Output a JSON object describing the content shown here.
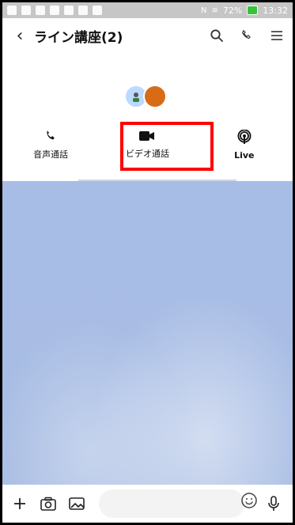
{
  "status_bar": {
    "battery_percent": "72%",
    "time": "13:32"
  },
  "header": {
    "title": "ライン講座(2)"
  },
  "call_options": [
    {
      "label": "音声通話"
    },
    {
      "label": "ビデオ通話"
    },
    {
      "label": "Live"
    }
  ],
  "composer": {
    "placeholder": ""
  },
  "colors": {
    "highlight": "#ff0000",
    "chat_background": "#a8bde6"
  }
}
